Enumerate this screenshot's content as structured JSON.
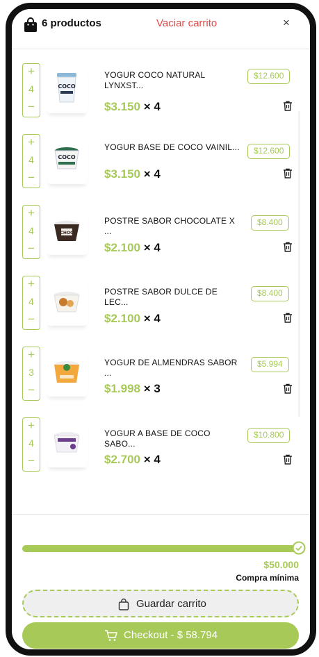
{
  "header": {
    "count_label": "6 productos",
    "clear_label": "Vaciar carrito",
    "close_glyph": "×"
  },
  "stepper": {
    "plus": "+",
    "minus": "−"
  },
  "items": [
    {
      "name": "YOGUR COCO NATURAL LYNXST...",
      "qty": "4",
      "price": "$3.150",
      "times": "× 4",
      "subtotal": "$12.600",
      "image_icon": "yogurt-cup-coco-natural"
    },
    {
      "name": "YOGUR BASE DE COCO VAINIL...",
      "qty": "4",
      "price": "$3.150",
      "times": "× 4",
      "subtotal": "$12.600",
      "image_icon": "yogurt-cup-coco-vainilla"
    },
    {
      "name": "POSTRE SABOR CHOCOLATE X ...",
      "qty": "4",
      "price": "$2.100",
      "times": "× 4",
      "subtotal": "$8.400",
      "image_icon": "dessert-cup-chocolate"
    },
    {
      "name": "POSTRE SABOR DULCE DE LEC...",
      "qty": "4",
      "price": "$2.100",
      "times": "× 4",
      "subtotal": "$8.400",
      "image_icon": "dessert-cup-dulce-de-leche"
    },
    {
      "name": "YOGUR DE ALMENDRAS SABOR ...",
      "qty": "3",
      "price": "$1.998",
      "times": "× 3",
      "subtotal": "$5.994",
      "image_icon": "yogurt-cup-almendras"
    },
    {
      "name": "YOGUR A BASE DE COCO SABO...",
      "qty": "4",
      "price": "$2.700",
      "times": "× 4",
      "subtotal": "$10.800",
      "image_icon": "yogurt-cup-coco-berry"
    }
  ],
  "footer": {
    "progress_fraction": 1.0,
    "goal_amount": "$50.000",
    "goal_label": "Compra mínima",
    "save_label": "Guardar carrito",
    "checkout_label": "Checkout - $ 58.794"
  },
  "colors": {
    "accent": "#a7c957",
    "danger": "#e24848",
    "text": "#111111"
  }
}
